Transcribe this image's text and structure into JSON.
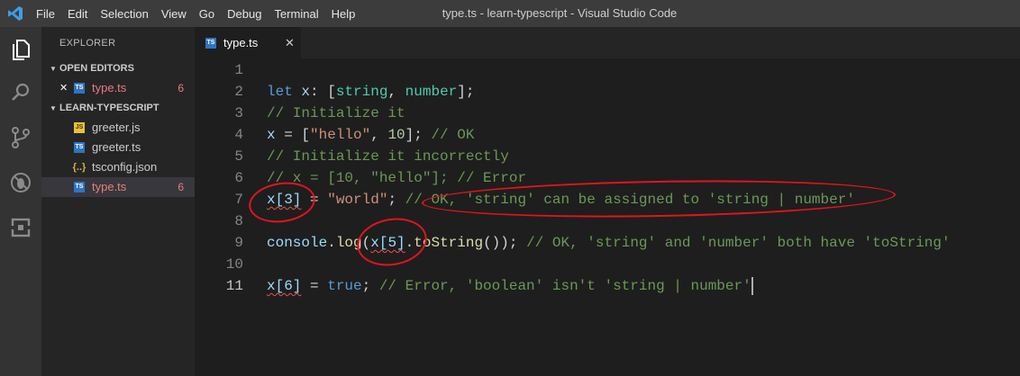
{
  "window": {
    "title": "type.ts - learn-typescript - Visual Studio Code",
    "menu": [
      "File",
      "Edit",
      "Selection",
      "View",
      "Go",
      "Debug",
      "Terminal",
      "Help"
    ]
  },
  "activity_bar": {
    "icons": [
      "files-icon",
      "search-icon",
      "source-control-icon",
      "debug-icon",
      "extensions-icon"
    ]
  },
  "sidebar": {
    "title": "EXPLORER",
    "open_editors": {
      "label": "OPEN EDITORS",
      "items": [
        {
          "close": "✕",
          "icon": "TS",
          "name": "type.ts",
          "problems": "6"
        }
      ]
    },
    "project": {
      "label": "LEARN-TYPESCRIPT",
      "files": [
        {
          "icon": "JS",
          "name": "greeter.js",
          "problems": ""
        },
        {
          "icon": "TS",
          "name": "greeter.ts",
          "problems": ""
        },
        {
          "icon": "{..}",
          "name": "tsconfig.json",
          "problems": ""
        },
        {
          "icon": "TS",
          "name": "type.ts",
          "problems": "6"
        }
      ]
    }
  },
  "tab": {
    "icon": "TS",
    "label": "type.ts",
    "close": "✕"
  },
  "editor": {
    "line_numbers": [
      "1",
      "2",
      "3",
      "4",
      "5",
      "6",
      "7",
      "8",
      "9",
      "10",
      "11"
    ],
    "lines": {
      "l2": [
        "let",
        " ",
        "x",
        ": [",
        "string",
        ", ",
        "number",
        "];"
      ],
      "l3": "// Initialize it",
      "l4": [
        "x",
        " = [",
        "\"hello\"",
        ", ",
        "10",
        "]; ",
        "// OK"
      ],
      "l5": "// Initialize it incorrectly",
      "l6": "// x = [10, \"hello\"]; // Error",
      "l7": [
        "x[3]",
        " = ",
        "\"world\"",
        "; ",
        "// OK, 'string' can be assigned to 'string | number'"
      ],
      "l9": [
        "console",
        ".",
        "log",
        "(",
        "x[5]",
        ".",
        "toString",
        "()); ",
        "// OK, 'string' and 'number' both have 'toString'"
      ],
      "l11": [
        "x[6]",
        " = ",
        "true",
        "; ",
        "// Error, 'boolean' isn't 'string | number'"
      ]
    }
  },
  "colors": {
    "annotation": "#e3141b",
    "error": "#e97d7d",
    "accent": "#007acc"
  }
}
